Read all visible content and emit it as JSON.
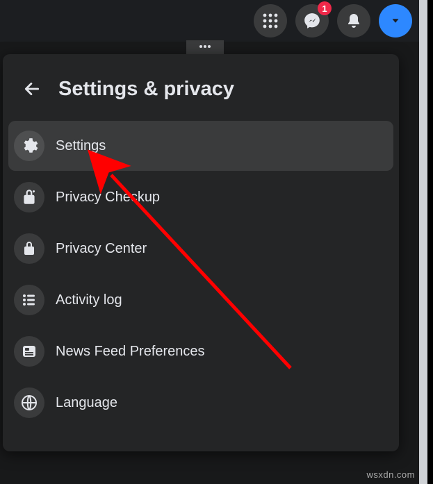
{
  "topbar": {
    "messenger_badge": "1"
  },
  "panel": {
    "title": "Settings & privacy",
    "items": [
      {
        "label": "Settings",
        "icon": "gear"
      },
      {
        "label": "Privacy Checkup",
        "icon": "lock-heart"
      },
      {
        "label": "Privacy Center",
        "icon": "lock"
      },
      {
        "label": "Activity log",
        "icon": "list"
      },
      {
        "label": "News Feed Preferences",
        "icon": "feed"
      },
      {
        "label": "Language",
        "icon": "globe"
      }
    ]
  },
  "watermark": "wsxdn.com"
}
